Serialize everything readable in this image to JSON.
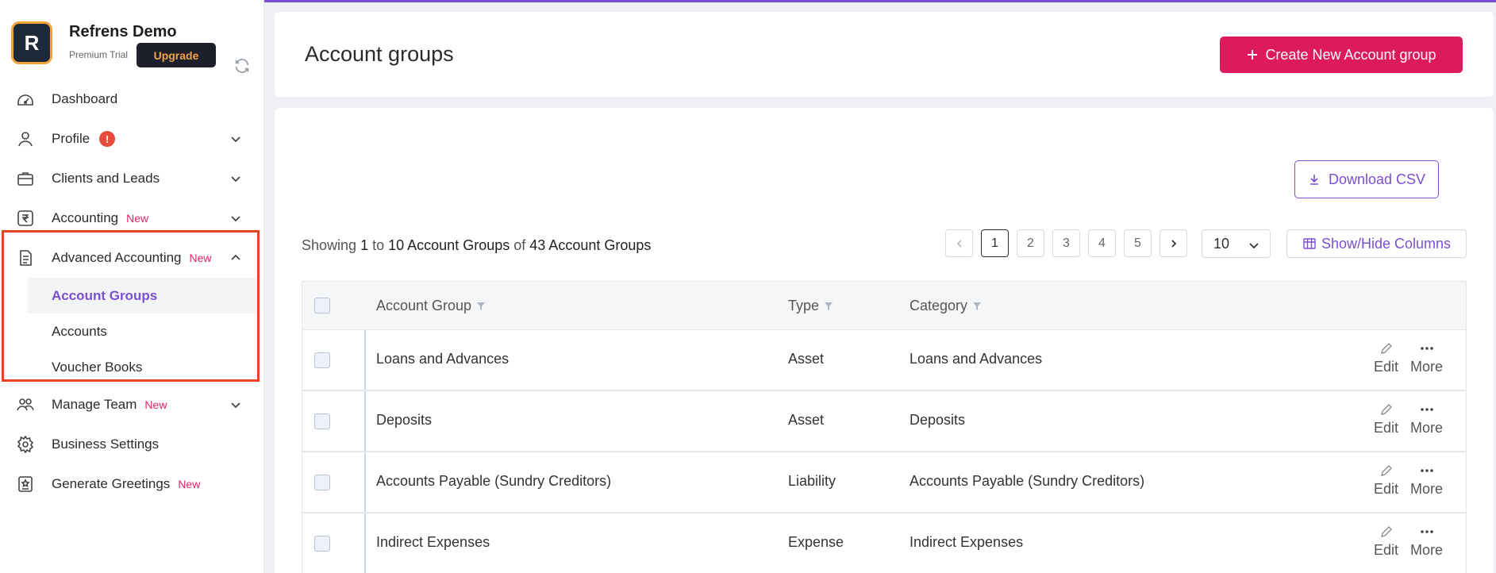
{
  "brand": {
    "avatar_letter": "R",
    "name": "Refrens Demo",
    "plan": "Premium Trial",
    "upgrade_label": "Upgrade"
  },
  "sidebar": {
    "items": [
      {
        "label": "Dashboard",
        "icon": "dashboard-icon"
      },
      {
        "label": "Profile",
        "icon": "user-icon",
        "alert": "!"
      },
      {
        "label": "Clients and Leads",
        "icon": "briefcase-icon"
      },
      {
        "label": "Accounting",
        "icon": "rupee-icon",
        "tag": "New"
      },
      {
        "label": "Advanced Accounting",
        "icon": "document-icon",
        "tag": "New"
      },
      {
        "label": "Manage Team",
        "icon": "team-icon",
        "tag": "New"
      },
      {
        "label": "Business Settings",
        "icon": "gear-icon"
      },
      {
        "label": "Generate Greetings",
        "icon": "greeting-icon",
        "tag": "New"
      }
    ],
    "sub_items": [
      "Account Groups",
      "Accounts",
      "Voucher Books"
    ]
  },
  "header": {
    "title": "Account groups",
    "create_label": "Create New Account group"
  },
  "toolbar": {
    "download_label": "Download CSV",
    "showing_prefix": "Showing",
    "showing_from": "1",
    "showing_to_word": "to",
    "showing_to": "10 Account Groups",
    "showing_of": "of",
    "showing_total": "43 Account Groups",
    "pages": [
      "1",
      "2",
      "3",
      "4",
      "5"
    ],
    "per_page": "10",
    "columns_label": "Show/Hide Columns"
  },
  "table": {
    "headers": {
      "group": "Account Group",
      "type": "Type",
      "category": "Category"
    },
    "rows": [
      {
        "group": "Loans and Advances",
        "type": "Asset",
        "category": "Loans and Advances"
      },
      {
        "group": "Deposits",
        "type": "Asset",
        "category": "Deposits"
      },
      {
        "group": "Accounts Payable (Sundry Creditors)",
        "type": "Liability",
        "category": "Accounts Payable (Sundry Creditors)"
      },
      {
        "group": "Indirect Expenses",
        "type": "Expense",
        "category": "Indirect Expenses"
      }
    ],
    "edit_label": "Edit",
    "more_label": "More"
  },
  "colors": {
    "accent": "#7b4fd1",
    "primary": "#dd1a5b",
    "highlight": "#e64525"
  }
}
